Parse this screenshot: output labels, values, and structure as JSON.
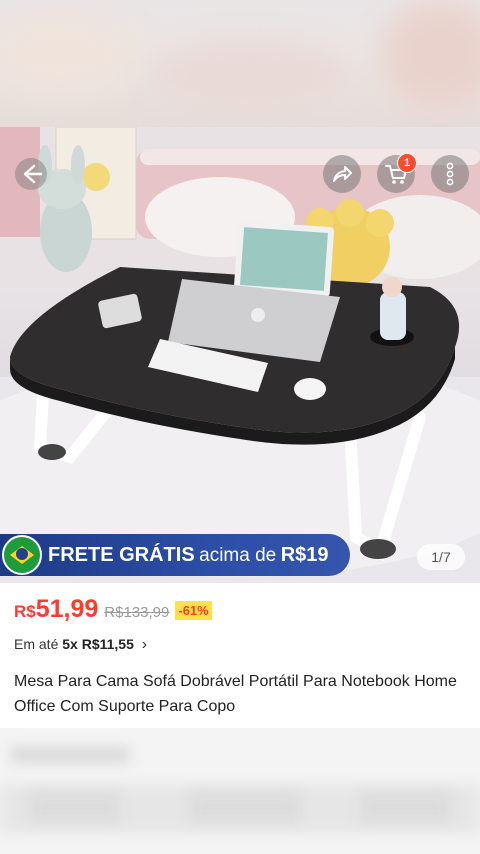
{
  "header": {
    "back_icon": "back-arrow-icon",
    "share_icon": "share-icon",
    "cart_icon": "cart-icon",
    "cart_badge": "1",
    "more_icon": "more-vertical-icon"
  },
  "gallery": {
    "page_indicator": "1/7"
  },
  "promo": {
    "frete_bold": "FRETE GRÁTIS",
    "frete_light": "acima de",
    "frete_value": "R$19",
    "flag_icon": "brazil-flag-icon",
    "color": "#2c4ea6"
  },
  "product": {
    "currency": "R$",
    "price": "51,99",
    "old_price": "R$133,99",
    "discount": "-61%",
    "installment_prefix": "Em até ",
    "installment_value": "5x R$11,55",
    "installment_chevron": "›",
    "title": "Mesa Para Cama Sofá Dobrável Portátil Para Notebook Home Office Com Suporte Para Copo",
    "accent_color": "#ff3b2f"
  }
}
